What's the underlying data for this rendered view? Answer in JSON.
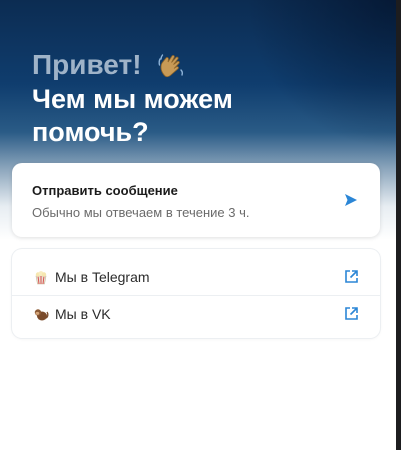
{
  "hero": {
    "greeting": "Привет!",
    "greeting_icon": "waving-hand-icon",
    "subtitle": "Чем мы можем помочь?"
  },
  "send_card": {
    "title": "Отправить сообщение",
    "description": "Обычно мы отвечаем в течение 3 ч.",
    "icon": "send-arrow-icon"
  },
  "links": [
    {
      "label": "Мы в Telegram",
      "emoji_icon": "popcorn-icon",
      "action_icon": "external-link-icon"
    },
    {
      "label": "Мы в VK",
      "emoji_icon": "monkey-icon",
      "action_icon": "external-link-icon"
    }
  ],
  "colors": {
    "accent": "#2b86d6",
    "hero_dark": "#0c2c52",
    "greeting_text": "#9fb3c8"
  }
}
